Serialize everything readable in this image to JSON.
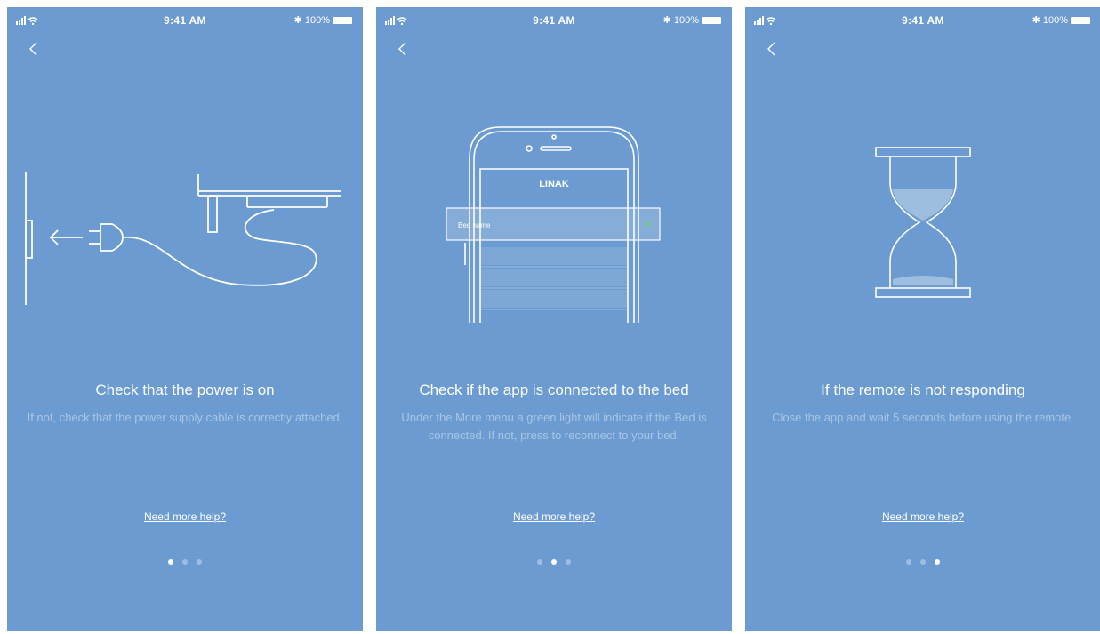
{
  "status_bar": {
    "time": "9:41 AM",
    "battery": "100%"
  },
  "screens": [
    {
      "title": "Check that the power is on",
      "description": "If not, check that the power supply cable is correctly attached.",
      "help": "Need more help?",
      "page_index": 0,
      "page_count": 3
    },
    {
      "title": "Check if the app is connected to the bed",
      "description": "Under the More menu a green light will indicate if the Bed is connected. If not, press to reconnect to your bed.",
      "help": "Need more help?",
      "page_index": 1,
      "page_count": 3,
      "phone_logo": "LINAK",
      "phone_row_label": "Bed name",
      "accent_green": "#6fd16f"
    },
    {
      "title": "If the remote is not responding",
      "description": "Close the app and wait 5 seconds before using the remote.",
      "help": "Need more help?",
      "page_index": 2,
      "page_count": 3
    }
  ],
  "colors": {
    "background": "#6b9bd0",
    "text": "#ffffff"
  }
}
